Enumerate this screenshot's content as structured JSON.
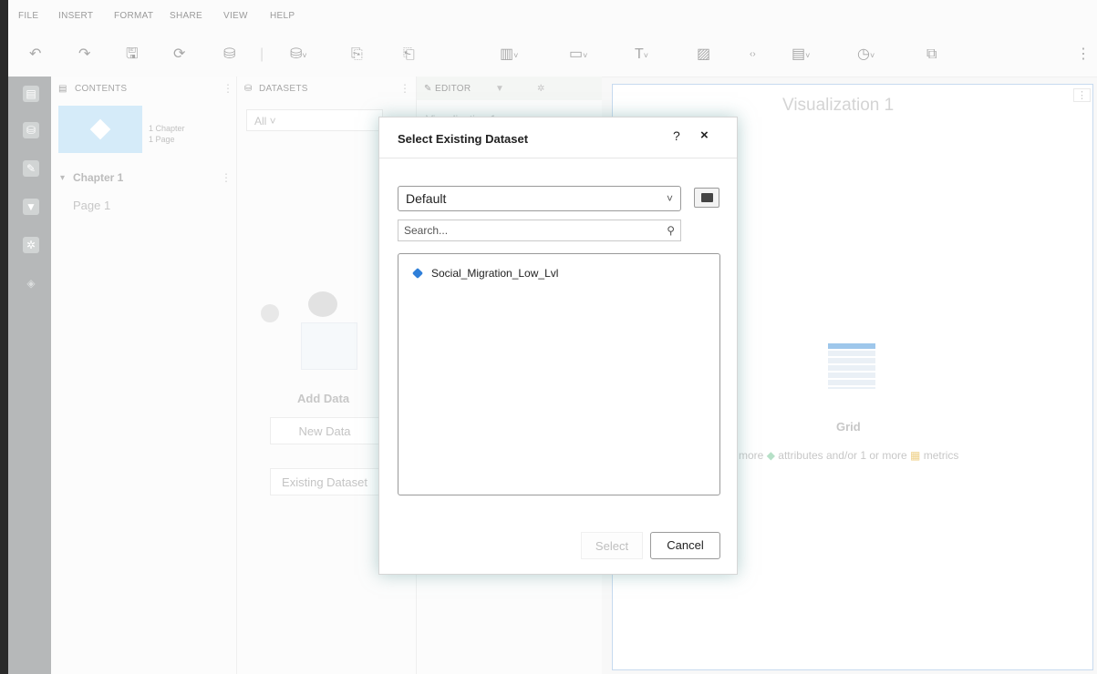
{
  "menu": [
    "FILE",
    "INSERT",
    "FORMAT",
    "SHARE",
    "VIEW",
    "HELP"
  ],
  "panels": {
    "contents": {
      "header": "CONTENTS",
      "thumb_chapters": "1 Chapter",
      "thumb_pages": "1 Page",
      "chapter": "Chapter 1",
      "page": "Page 1"
    },
    "datasets": {
      "header": "DATASETS",
      "filter": "All",
      "add_data": "Add Data",
      "new_data": "New Data",
      "existing_dataset": "Existing Dataset"
    },
    "editor": {
      "tab": "EDITOR",
      "viz_name": "Visualization 1"
    }
  },
  "visualization": {
    "title": "Visualization 1",
    "grid_label": "Grid",
    "hint_part1": "more",
    "hint_part2": "attributes and/or 1 or more",
    "hint_part3": "metrics"
  },
  "dialog": {
    "title": "Select Existing Dataset",
    "help": "?",
    "close": "×",
    "folder": "Default",
    "search_placeholder": "Search...",
    "items": [
      "Social_Migration_Low_Lvl"
    ],
    "select_label": "Select",
    "cancel_label": "Cancel"
  },
  "colors": {
    "accent": "#2f7fd9",
    "vis_border": "#aac6e6",
    "rail": "#8f9394"
  }
}
